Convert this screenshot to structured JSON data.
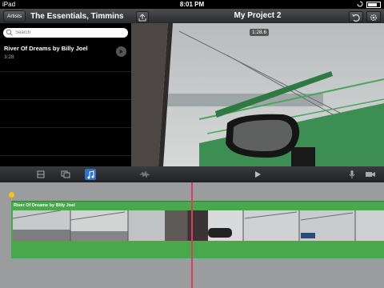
{
  "status_bar": {
    "carrier": "iPad",
    "time": "8:01 PM"
  },
  "library": {
    "back_button": "Artists",
    "title": "The Essentials, Timmins",
    "search_placeholder": "Search",
    "songs": [
      {
        "title": "River Of Dreams by Billy Joel",
        "duration": "3:28"
      }
    ]
  },
  "project": {
    "title": "My Project 2",
    "time_readout": "1:28.6"
  },
  "timeline": {
    "audio_clip_label": "River Of Dreams by Billy Joel"
  },
  "colors": {
    "audio_clip": "#47a94b",
    "playhead": "#e23b55",
    "active_tool": "#2f73c7"
  },
  "icons": [
    "search-icon",
    "play-icon",
    "share-icon",
    "undo-icon",
    "gear-icon",
    "video-clips-icon",
    "photos-icon",
    "music-icon",
    "waveform-icon",
    "microphone-icon",
    "camera-icon",
    "lock-rotation-icon",
    "battery-icon"
  ]
}
